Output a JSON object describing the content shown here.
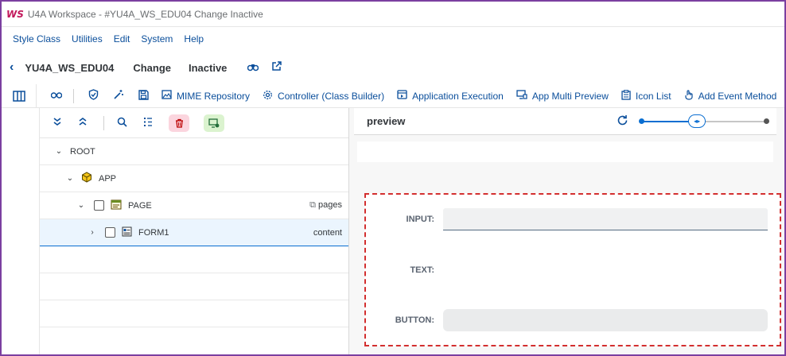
{
  "window": {
    "logo_text": "WS",
    "title": "U4A Workspace - #YU4A_WS_EDU04 Change Inactive"
  },
  "menu": [
    "Style Class",
    "Utilities",
    "Edit",
    "System",
    "Help"
  ],
  "header": {
    "app_id": "YU4A_WS_EDU04",
    "mode": "Change",
    "status": "Inactive"
  },
  "toolbar": {
    "buttons": [
      {
        "label": "MIME Repository",
        "icon": "image-icon"
      },
      {
        "label": "Controller (Class Builder)",
        "icon": "gear-icon"
      },
      {
        "label": "Application Execution",
        "icon": "run-icon"
      },
      {
        "label": "App Multi Preview",
        "icon": "monitor-icon"
      },
      {
        "label": "Icon List",
        "icon": "clipboard-icon"
      },
      {
        "label": "Add Event Method",
        "icon": "hand-icon"
      }
    ]
  },
  "tree": {
    "rows": [
      {
        "label": "ROOT",
        "right": ""
      },
      {
        "label": "APP",
        "right": ""
      },
      {
        "label": "PAGE",
        "right": "pages"
      },
      {
        "label": "FORM1",
        "right": "content"
      }
    ]
  },
  "preview": {
    "title": "preview",
    "slider_fraction": 0.45,
    "form": {
      "input_label": "INPUT:",
      "text_label": "TEXT:",
      "button_label": "BUTTON:"
    }
  },
  "colors": {
    "accent": "#0a4e9b",
    "border_frame": "#7b3fa0",
    "dashed": "#d32f2f",
    "selection": "#ebf5fe"
  }
}
